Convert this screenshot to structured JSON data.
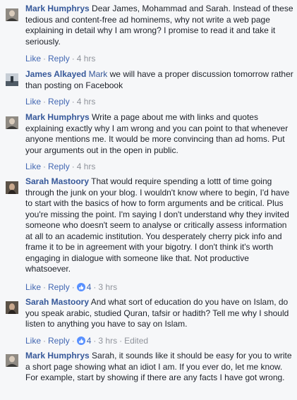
{
  "comments": [
    {
      "author": "Mark Humphrys",
      "mention": "",
      "text": "Dear James, Mohammad and Sarah. Instead of these tedious and content-free ad hominems, why not write a web page explaining in detail why I am wrong? I promise to read it and take it seriously.",
      "like_label": "Like",
      "reply_label": "Reply",
      "like_count": "",
      "time": "4 hrs",
      "edited": ""
    },
    {
      "author": "James Alkayed",
      "mention": "Mark",
      "text": "we will have a proper discussion tomorrow rather than posting on Facebook",
      "like_label": "Like",
      "reply_label": "Reply",
      "like_count": "",
      "time": "4 hrs",
      "edited": ""
    },
    {
      "author": "Mark Humphrys",
      "mention": "",
      "text": "Write a page about me with links and quotes explaining exactly why I am wrong and you can point to that whenever anyone mentions me. It would be more convincing than ad homs. Put your arguments out in the open in public.",
      "like_label": "Like",
      "reply_label": "Reply",
      "like_count": "",
      "time": "4 hrs",
      "edited": ""
    },
    {
      "author": "Sarah Mastoory",
      "mention": "",
      "text": "That would require spending a lottt of time going through the junk on your blog. I wouldn't know where to begin, I'd have to start with the basics of how to form arguments and be critical. Plus you're missing the point. I'm saying I don't understand why they invited someone who doesn't seem to analyse or critically assess information at all to an academic institution. You desperately cherry pick info and frame it to be in agreement with your bigotry. I don't think it's worth engaging in dialogue with someone like that. Not productive whatsoever.",
      "like_label": "Like",
      "reply_label": "Reply",
      "like_count": "4",
      "time": "3 hrs",
      "edited": ""
    },
    {
      "author": "Sarah Mastoory",
      "mention": "",
      "text": "And what sort of education do you have on Islam, do you speak arabic, studied Quran, tafsir or hadith? Tell me why I should listen to anything you have to say on Islam.",
      "like_label": "Like",
      "reply_label": "Reply",
      "like_count": "4",
      "time": "3 hrs",
      "edited": "Edited"
    },
    {
      "author": "Mark Humphrys",
      "mention": "",
      "text": "Sarah, it sounds like it should be easy for you to write a short page showing what an idiot I am. If you ever do, let me know. For example, start by showing if there are any facts I have got wrong.",
      "like_label": "",
      "reply_label": "",
      "like_count": "",
      "time": "",
      "edited": ""
    }
  ],
  "colors": {
    "author": "#365899",
    "link": "#4267b2",
    "meta": "#90949c",
    "text": "#1d2129",
    "background": "#f6f7f9",
    "like_badge": "#5890ff"
  }
}
